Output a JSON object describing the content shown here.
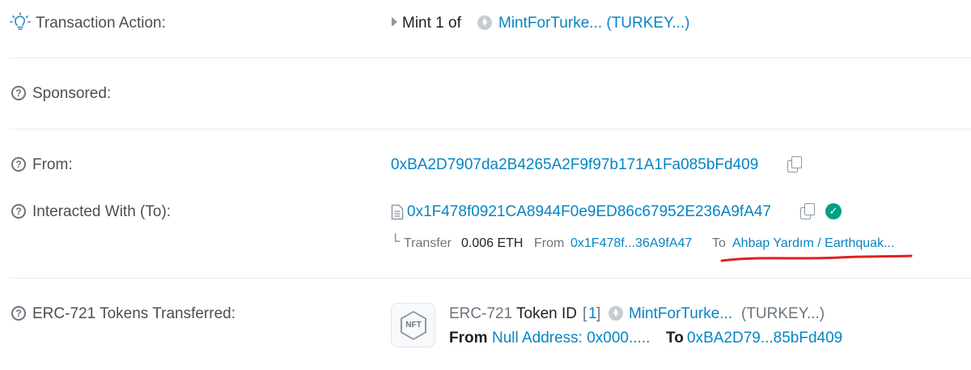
{
  "transaction_action": {
    "label": "Transaction Action:",
    "verb": "Mint 1 of",
    "token": "MintForTurke... (TURKEY...)"
  },
  "sponsored": {
    "label": "Sponsored:"
  },
  "from": {
    "label": "From:",
    "address": "0xBA2D7907da2B4265A2F9f97b171A1Fa085bFd409"
  },
  "interacted_with": {
    "label": "Interacted With (To):",
    "address": "0x1F478f0921CA8944F0e9ED86c67952E236A9fA47",
    "internal": {
      "prefix": "└",
      "kind": "Transfer",
      "amount": "0.006 ETH",
      "from_label": "From",
      "from_address": "0x1F478f...36A9fA47",
      "to_label": "To",
      "to_name": "Ahbap Yardım / Earthquak..."
    }
  },
  "tokens_transferred": {
    "label": "ERC-721 Tokens Transferred:",
    "standard": "ERC-721",
    "token_id_label": "Token ID",
    "token_id_open": "[",
    "token_id": "1",
    "token_id_close": "]",
    "token_name": "MintForTurke...",
    "token_symbol": "(TURKEY...)",
    "nft_badge": "NFT",
    "from_label": "From",
    "from_address": "Null Address: 0x000.....",
    "to_label": "To",
    "to_address": "0xBA2D79...85bFd409"
  },
  "icons": {
    "lightbulb": "lightbulb-icon",
    "question": "question-circle-icon",
    "copy": "copy-icon",
    "verified": "verified-check-icon",
    "contract": "contract-file-icon",
    "eth": "eth-token-icon",
    "caret": "caret-right-icon"
  },
  "colors": {
    "link": "#0784c3",
    "label": "#4a4f55",
    "verified": "#00a186",
    "annotation": "#e02020"
  }
}
